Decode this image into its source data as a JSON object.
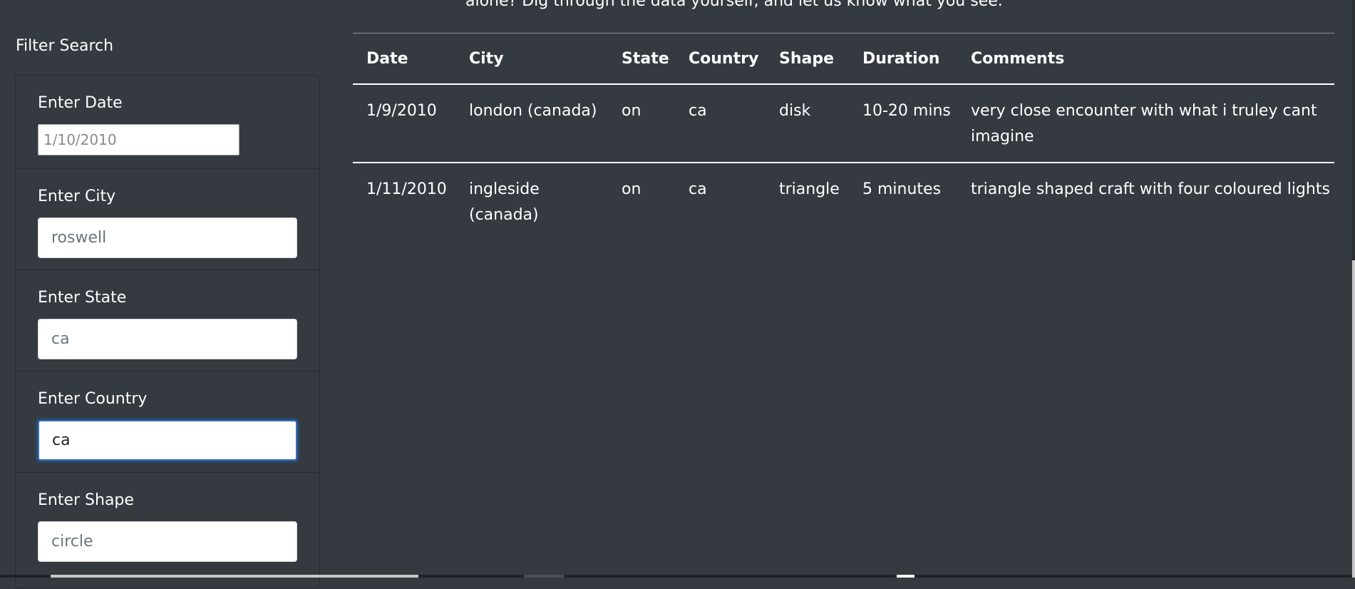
{
  "intro": {
    "text": "alone? Dig through the data yourself, and let us know what you see."
  },
  "sidebar": {
    "title": "Filter Search",
    "filters": [
      {
        "label": "Enter Date",
        "value": "",
        "placeholder": "1/10/2010",
        "name": "date"
      },
      {
        "label": "Enter City",
        "value": "",
        "placeholder": "roswell",
        "name": "city"
      },
      {
        "label": "Enter State",
        "value": "",
        "placeholder": "ca",
        "name": "state"
      },
      {
        "label": "Enter Country",
        "value": "ca",
        "placeholder": "",
        "name": "country",
        "focused": true
      },
      {
        "label": "Enter Shape",
        "value": "",
        "placeholder": "circle",
        "name": "shape"
      }
    ]
  },
  "table": {
    "headers": [
      "Date",
      "City",
      "State",
      "Country",
      "Shape",
      "Duration",
      "Comments"
    ],
    "rows": [
      [
        "1/9/2010",
        "london (canada)",
        "on",
        "ca",
        "disk",
        "10-20 mins",
        "very close encounter with what i truley cant imagine"
      ],
      [
        "1/11/2010",
        "ingleside (canada)",
        "on",
        "ca",
        "triangle",
        "5 minutes",
        "triangle shaped craft with four coloured lights"
      ]
    ]
  },
  "colors": {
    "background": "#343a40",
    "text": "#ffffff",
    "focus_border": "#3d6db5"
  }
}
